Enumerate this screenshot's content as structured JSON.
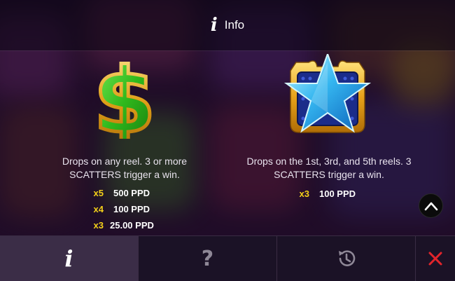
{
  "header": {
    "title": "Info",
    "icon": "info-icon"
  },
  "symbols": [
    {
      "icon": "dollar-symbol-icon",
      "description_line1": "Drops on any reel. 3 or more",
      "description_line2": "SCATTERS trigger a win.",
      "payouts": [
        {
          "multiplier": "x5",
          "amount": "500 PPD"
        },
        {
          "multiplier": "x4",
          "amount": "100 PPD"
        },
        {
          "multiplier": "x3",
          "amount": "25.00 PPD"
        }
      ]
    },
    {
      "icon": "star-symbol-icon",
      "description_line1": "Drops on the 1st, 3rd, and 5th reels. 3",
      "description_line2": "SCATTERS trigger a win.",
      "payouts": [
        {
          "multiplier": "x3",
          "amount": "100 PPD"
        }
      ]
    }
  ],
  "footer": {
    "tabs": [
      {
        "name": "info",
        "icon": "info-icon",
        "active": true
      },
      {
        "name": "help",
        "icon": "question-icon",
        "active": false
      },
      {
        "name": "history",
        "icon": "history-icon",
        "active": false
      },
      {
        "name": "close",
        "icon": "close-icon",
        "active": false
      }
    ]
  },
  "colors": {
    "multiplier": "#f3d019",
    "close": "#e3242b",
    "active_tab": "#3b2d47"
  }
}
